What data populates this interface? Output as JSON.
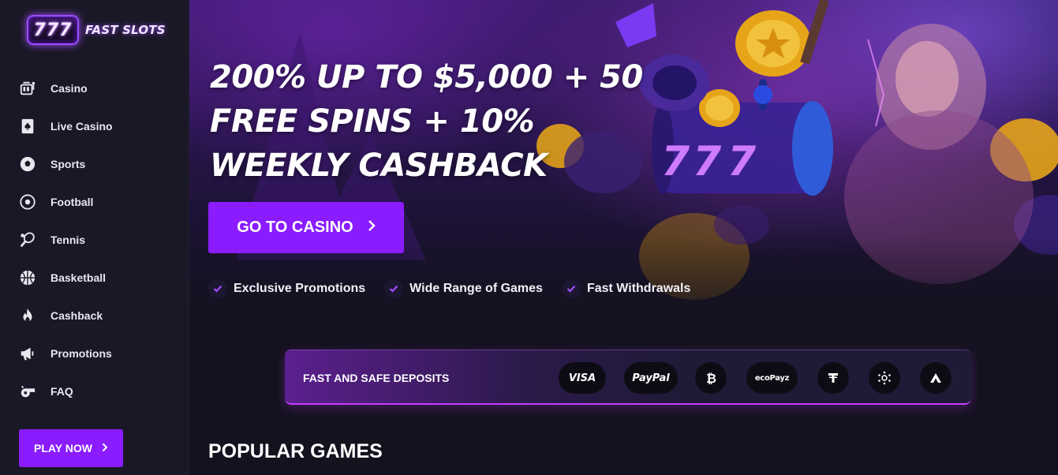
{
  "brand": {
    "logo_number": "777",
    "name": "FAST SLOTS"
  },
  "sidebar": {
    "items": [
      {
        "label": "Casino",
        "icon": "casino-icon"
      },
      {
        "label": "Live Casino",
        "icon": "playing-card-icon"
      },
      {
        "label": "Sports",
        "icon": "sports-ball-icon"
      },
      {
        "label": "Football",
        "icon": "football-icon"
      },
      {
        "label": "Tennis",
        "icon": "tennis-icon"
      },
      {
        "label": "Basketball",
        "icon": "basketball-icon"
      },
      {
        "label": "Cashback",
        "icon": "flame-icon"
      },
      {
        "label": "Promotions",
        "icon": "megaphone-icon"
      },
      {
        "label": "FAQ",
        "icon": "whistle-icon"
      }
    ],
    "play_now": "PLAY NOW"
  },
  "hero": {
    "title": "200% UP TO $5,000 + 50 FREE SPINS + 10% WEEKLY CASHBACK",
    "cta": "GO TO CASINO",
    "features": [
      "Exclusive Promotions",
      "Wide Range of Games",
      "Fast Withdrawals"
    ],
    "slot_digits": [
      "7",
      "7",
      "7"
    ]
  },
  "deposits": {
    "label": "FAST AND SAFE DEPOSITS",
    "methods": [
      {
        "name": "VISA",
        "icon": "visa-icon"
      },
      {
        "name": "PayPal",
        "icon": "paypal-icon"
      },
      {
        "name": "",
        "icon": "bitcoin-icon"
      },
      {
        "name": "ecoPayz",
        "icon": "ecopayz-icon"
      },
      {
        "name": "",
        "icon": "tether-icon"
      },
      {
        "name": "",
        "icon": "cardano-icon"
      },
      {
        "name": "",
        "icon": "avalanche-icon"
      }
    ]
  },
  "popular": {
    "title": "POPULAR GAMES"
  },
  "colors": {
    "accent": "#8a1cff",
    "background": "#14121f",
    "sidebar": "#1a1826"
  }
}
